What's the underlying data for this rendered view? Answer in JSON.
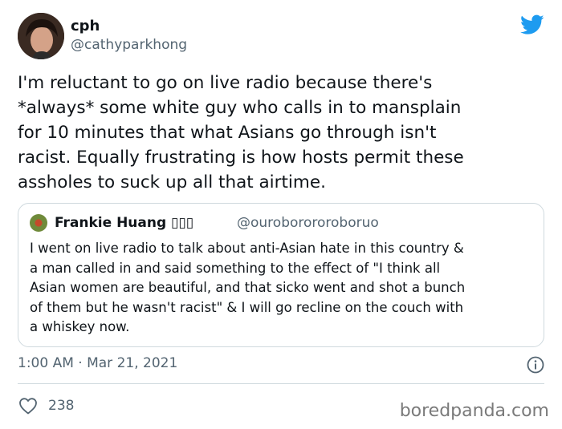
{
  "author": {
    "display_name": "cph",
    "handle": "@cathyparkhong"
  },
  "tweet": {
    "text": "I'm reluctant to go on live radio because there's\n*always* some white guy who calls in to mansplain\nfor 10 minutes that what Asians go through isn't\nracist. Equally frustrating is how hosts permit these\nassholes to suck up all that airtime.",
    "timestamp": "1:00 AM · Mar 21, 2021",
    "likes": "238"
  },
  "quoted_tweet": {
    "display_name": "Frankie Huang ▯▯▯",
    "handle": "@ouroborororoboruo",
    "text": "I went on live radio to talk about anti-Asian hate in this country &\na man called in and said something to the effect of \"I think all\nAsian women are beautiful, and that sicko went and shot a bunch\nof them but he wasn't racist\" & I will go recline on the couch with\na whiskey now."
  },
  "watermark": "boredpanda.com",
  "icons": {
    "brand": "twitter-bird-icon",
    "info": "info-icon",
    "like": "heart-icon"
  },
  "colors": {
    "brand_blue": "#1d9bf0",
    "secondary_text": "#536471",
    "border": "#cfd9de"
  }
}
